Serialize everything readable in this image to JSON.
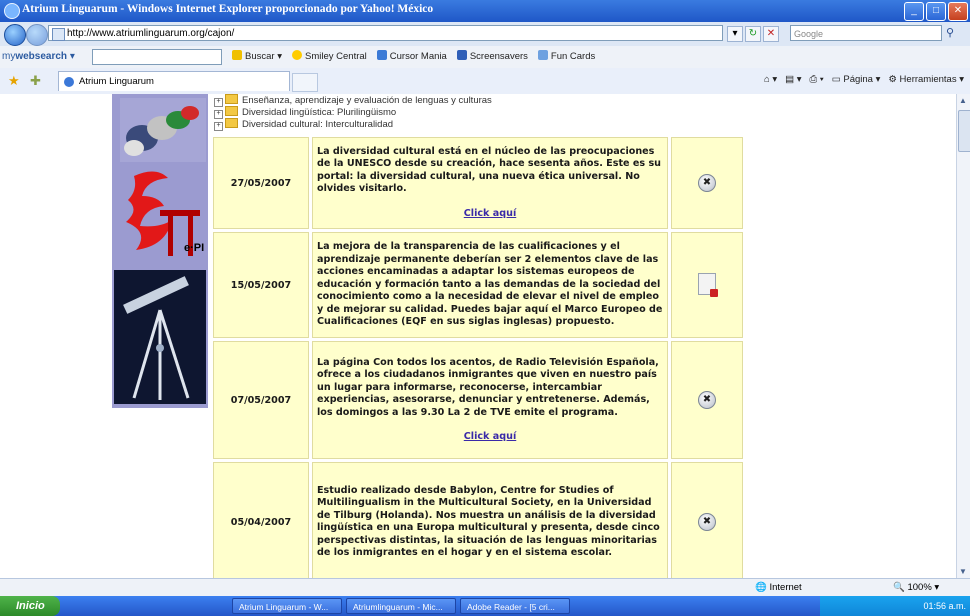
{
  "window": {
    "title": "Atrium Linguarum - Windows Internet Explorer proporcionado por Yahoo! México"
  },
  "address_bar": {
    "url": "http://www.atriumlinguarum.org/cajon/",
    "search_placeholder": "Google"
  },
  "links_bar": {
    "brand_prefix": "my",
    "brand_main": "websearch",
    "buscar": "Buscar",
    "items": [
      "Smiley Central",
      "Cursor Mania",
      "Screensavers",
      "Fun Cards"
    ]
  },
  "tab_bar": {
    "active_tab": "Atrium Linguarum",
    "pagina": "Página",
    "herramientas": "Herramientas"
  },
  "tree": [
    "Enseñanza, aprendizaje y evaluación de lenguas y culturas",
    "Diversidad lingüística: Plurilingüismo",
    "Diversidad cultural: Interculturalidad"
  ],
  "news": [
    {
      "date": "27/05/2007",
      "text": "La diversidad cultural está en el núcleo de las preocupaciones de la UNESCO desde su creación, hace sesenta años. Este es su portal: la diversidad cultural, una nueva ética universal. No olvides visitarlo.",
      "link": "Click aquí",
      "icon": "link-x-icon"
    },
    {
      "date": "15/05/2007",
      "text": "La mejora de la transparencia de las cualificaciones y el aprendizaje permanente deberían ser 2 elementos clave de las acciones encaminadas a adaptar los sistemas europeos de educación y formación tanto a las demandas de la sociedad del conocimiento como a la necesidad de elevar el nivel de empleo y de mejorar su calidad. Puedes bajar aquí el Marco Europeo de Cualificaciones (EQF en sus siglas inglesas) propuesto.",
      "link": "",
      "icon": "pdf-document-icon"
    },
    {
      "date": "07/05/2007",
      "text": "La página Con todos los acentos, de Radio Televisión Española, ofrece a los ciudadanos inmigrantes que viven en nuestro país un lugar para informarse, reconocerse, intercambiar experiencias, asesorarse, denunciar y entretenerse. Además, los domingos a las 9.30 La 2 de TVE emite el programa.",
      "link": "Click aquí",
      "icon": "link-x-icon"
    },
    {
      "date": "05/04/2007",
      "text": "Estudio realizado desde Babylon, Centre for Studies of Multilingualism in the Multicultural Society, en la Universidad de Tilburg (Holanda). Nos muestra un análisis de la diversidad lingüística en una Europa multicultural y presenta, desde cinco perspectivas distintas, la situación de las lenguas minoritarias de los inmigrantes en el hogar y en el sistema escolar.",
      "link": "",
      "icon": "link-x-icon"
    }
  ],
  "status_bar": {
    "zone": "Internet",
    "zoom": "100%"
  },
  "taskbar": {
    "start": "Inicio",
    "tasks": [
      "Atrium Linguarum - W...",
      "Atriumlinguarum - Mic...",
      "Adobe Reader - [5 cri..."
    ],
    "clock": "01:56 a.m."
  }
}
